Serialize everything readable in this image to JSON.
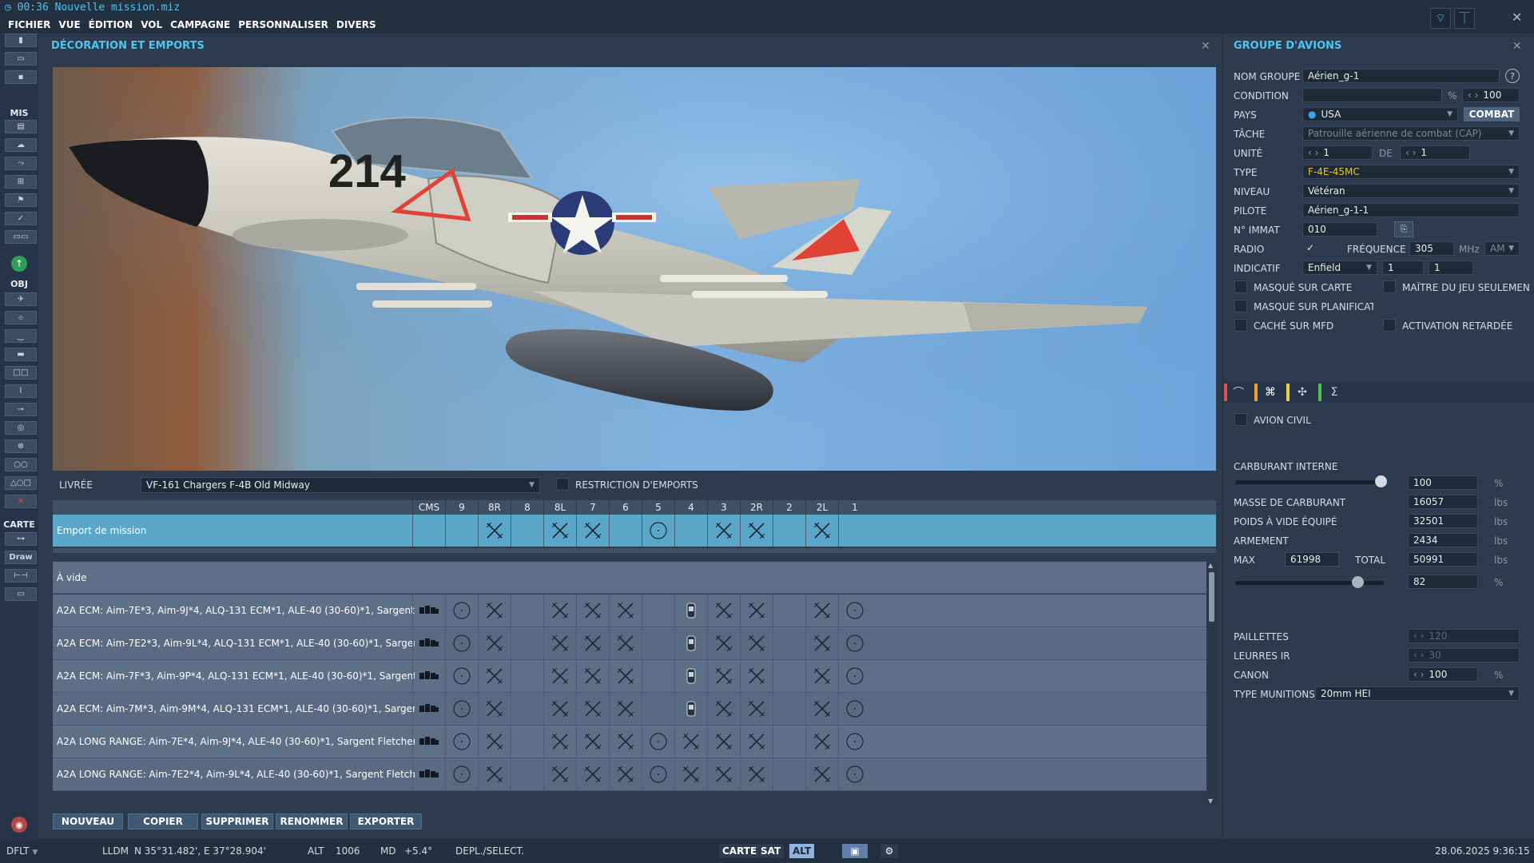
{
  "window": {
    "title": "00:36 Nouvelle mission.miz"
  },
  "menu": [
    "FICHIER",
    "VUE",
    "ÉDITION",
    "VOL",
    "CAMPAGNE",
    "PERSONNALISER",
    "DIVERS"
  ],
  "left_toolbar": {
    "mis_label": "MIS",
    "obj_label": "OBJ",
    "carte_label": "CARTE",
    "draw_label": "Draw"
  },
  "deco": {
    "title": "DÉCORATION ET EMPORTS",
    "livery_label": "LIVRÉE",
    "livery_value": "VF-161 Chargers F-4B Old Midway",
    "restriction_label": "RESTRICTION D'EMPORTS",
    "columns": [
      "CMS",
      "9",
      "8R",
      "8",
      "8L",
      "7",
      "6",
      "5",
      "4",
      "3",
      "2R",
      "2",
      "2L",
      "1"
    ],
    "mission_row": {
      "name": "Emport de mission",
      "stations": [
        "",
        "",
        "x",
        "",
        "x",
        "x",
        "",
        "o",
        "",
        "x",
        "x",
        "",
        "x",
        ""
      ]
    },
    "empty_row": "À vide",
    "loadouts": [
      {
        "name": "A2A ECM: Aim-7E*3, Aim-9J*4, ALQ-131 ECM*1, ALE-40 (30-60)*1, Sargent Fletcher",
        "stations": [
          "cms",
          "o",
          "x",
          "",
          "x",
          "x",
          "x",
          "",
          "pod",
          "x",
          "x",
          "",
          "x",
          "o"
        ]
      },
      {
        "name": "A2A ECM: Aim-7E2*3, Aim-9L*4, ALQ-131 ECM*1, ALE-40 (30-60)*1, Sargent Fletch",
        "stations": [
          "cms",
          "o",
          "x",
          "",
          "x",
          "x",
          "x",
          "",
          "pod",
          "x",
          "x",
          "",
          "x",
          "o"
        ]
      },
      {
        "name": "A2A ECM: Aim-7F*3, Aim-9P*4, ALQ-131 ECM*1, ALE-40 (30-60)*1, Sargent Fletche",
        "stations": [
          "cms",
          "o",
          "x",
          "",
          "x",
          "x",
          "x",
          "",
          "pod",
          "x",
          "x",
          "",
          "x",
          "o"
        ]
      },
      {
        "name": "A2A ECM: Aim-7M*3, Aim-9M*4, ALQ-131 ECM*1, ALE-40 (30-60)*1, Sargent Fletch",
        "stations": [
          "cms",
          "o",
          "x",
          "",
          "x",
          "x",
          "x",
          "",
          "pod",
          "x",
          "x",
          "",
          "x",
          "o"
        ]
      },
      {
        "name": "A2A LONG RANGE: Aim-7E*4, Aim-9J*4, ALE-40 (30-60)*1, Sargent Fletcher Fuel Ta",
        "stations": [
          "cms",
          "o",
          "x",
          "",
          "x",
          "x",
          "x",
          "o",
          "x",
          "x",
          "x",
          "",
          "x",
          "o"
        ]
      },
      {
        "name": "A2A LONG RANGE: Aim-7E2*4, Aim-9L*4, ALE-40 (30-60)*1, Sargent Fletcher Fuel T",
        "stations": [
          "cms",
          "o",
          "x",
          "",
          "x",
          "x",
          "x",
          "o",
          "x",
          "x",
          "x",
          "",
          "x",
          "o"
        ]
      }
    ],
    "buttons": {
      "new": "NOUVEAU",
      "copy": "COPIER",
      "delete": "SUPPRIMER",
      "rename": "RENOMMER",
      "export": "EXPORTER"
    },
    "aircraft": {
      "tail_number": "214"
    }
  },
  "group": {
    "title": "GROUPE D'AVIONS",
    "name_label": "NOM GROUPE",
    "name_value": "Aérien_g-1",
    "help": "?",
    "condition_label": "CONDITION",
    "condition_unit": "%",
    "condition_value": "100",
    "country_label": "PAYS",
    "country_value": "USA",
    "combat_btn": "COMBAT",
    "task_label": "TÂCHE",
    "task_value": "Patrouille aérienne de combat (CAP)",
    "unit_label": "UNITÉ",
    "unit_value": "1",
    "of_label": "DE",
    "unit_of_value": "1",
    "type_label": "TYPE",
    "type_value": "F-4E-45MC",
    "skill_label": "NIVEAU",
    "skill_value": "Vétéran",
    "pilot_label": "PILOTE",
    "pilot_value": "Aérien_g-1-1",
    "tail_label": "N° IMMAT",
    "tail_value": "010",
    "radio_label": "RADIO",
    "freq_label": "FRÉQUENCE",
    "freq_value": "305",
    "freq_unit": "MHz",
    "modulation": "AM",
    "callsign_label": "INDICATIF",
    "callsign_value": "Enfield",
    "callsign_n1": "1",
    "callsign_n2": "1",
    "hidden_map": "MASQUÉ SUR CARTE",
    "gm_only": "MAÎTRE DU JEU SEULEMEN",
    "hidden_planner": "MASQUÉ SUR PLANIFICATI",
    "hidden_mfd": "CACHÉ SUR MFD",
    "late_activation": "ACTIVATION RETARDÉE"
  },
  "payload": {
    "civil_label": "AVION CIVIL",
    "fuel_label": "CARBURANT INTERNE",
    "fuel_value": "100",
    "fuel_fraction": 1.0,
    "pct": "%",
    "fuel_mass_label": "MASSE DE CARBURANT",
    "fuel_mass_value": "16057",
    "empty_weight_label": "POIDS À VIDE ÉQUIPÉ",
    "empty_weight_value": "32501",
    "weapons_label": "ARMEMENT",
    "weapons_value": "2434",
    "max_label": "MAX",
    "max_value": "61998",
    "total_label": "TOTAL",
    "total_value": "50991",
    "weight_pct_value": "82",
    "weight_fraction": 0.82,
    "lbs": "lbs",
    "chaff_label": "PAILLETTES",
    "chaff_value": "120",
    "flares_label": "LEURRES IR",
    "flares_value": "30",
    "gun_label": "CANON",
    "gun_value": "100",
    "ammo_label": "TYPE MUNITIONS",
    "ammo_value": "20mm HEI",
    "tab_colors": [
      "#e05050",
      "#f0a030",
      "#e8d040",
      "#50c050"
    ]
  },
  "status": {
    "layer": "DFLT",
    "coord_format": "LLDM",
    "coords": "N 35°31.482', E 37°28.904'",
    "alt_label": "ALT",
    "alt_value": "1006",
    "md_label": "MD",
    "md_value": "+5.4°",
    "mode": "DEPL./SELECT.",
    "map_btn": "CARTE",
    "sat_btn": "SAT",
    "alt_btn": "ALT",
    "datetime": "28.06.2025 9:36:15"
  }
}
